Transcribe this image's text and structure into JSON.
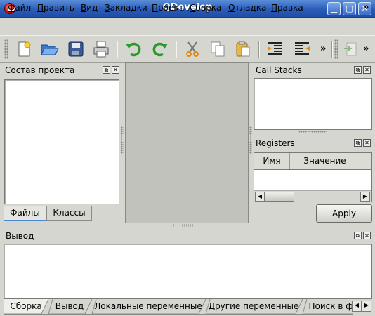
{
  "window": {
    "title": "QDevelop"
  },
  "menubar": {
    "items": [
      {
        "first": "Ф",
        "rest": "айл"
      },
      {
        "first": "П",
        "rest": "равить"
      },
      {
        "first": "В",
        "rest": "ид"
      },
      {
        "first": "З",
        "rest": "акладки"
      },
      {
        "first": "П",
        "rest": "роект"
      },
      {
        "first": "С",
        "rest": "борка"
      },
      {
        "first": "О",
        "rest": "тладка"
      },
      {
        "first": "П",
        "rest": "равка"
      }
    ],
    "more": "»"
  },
  "toolbar": {
    "more": "»",
    "icons": [
      "new-file-icon",
      "open-folder-icon",
      "save-icon",
      "print-icon",
      "undo-icon",
      "redo-icon",
      "cut-icon",
      "copy-icon",
      "paste-icon",
      "indent-icon",
      "unindent-icon",
      "go-to-icon"
    ]
  },
  "project_panel": {
    "title": "Состав проекта",
    "tabs": [
      "Файлы",
      "Классы"
    ]
  },
  "call_stacks": {
    "title": "Call Stacks"
  },
  "registers": {
    "title": "Registers",
    "columns": [
      "Имя",
      "Значение"
    ],
    "apply_label": "Apply"
  },
  "output": {
    "title": "Вывод",
    "tabs": [
      "Сборка",
      "Вывод",
      "Локальные переменные",
      "Другие переменные",
      "Поиск в ф"
    ]
  },
  "colors": {
    "titlebar": "#2a5cb8",
    "tab_active_accent": "#4a86d6",
    "background": "#d6d6d0"
  }
}
